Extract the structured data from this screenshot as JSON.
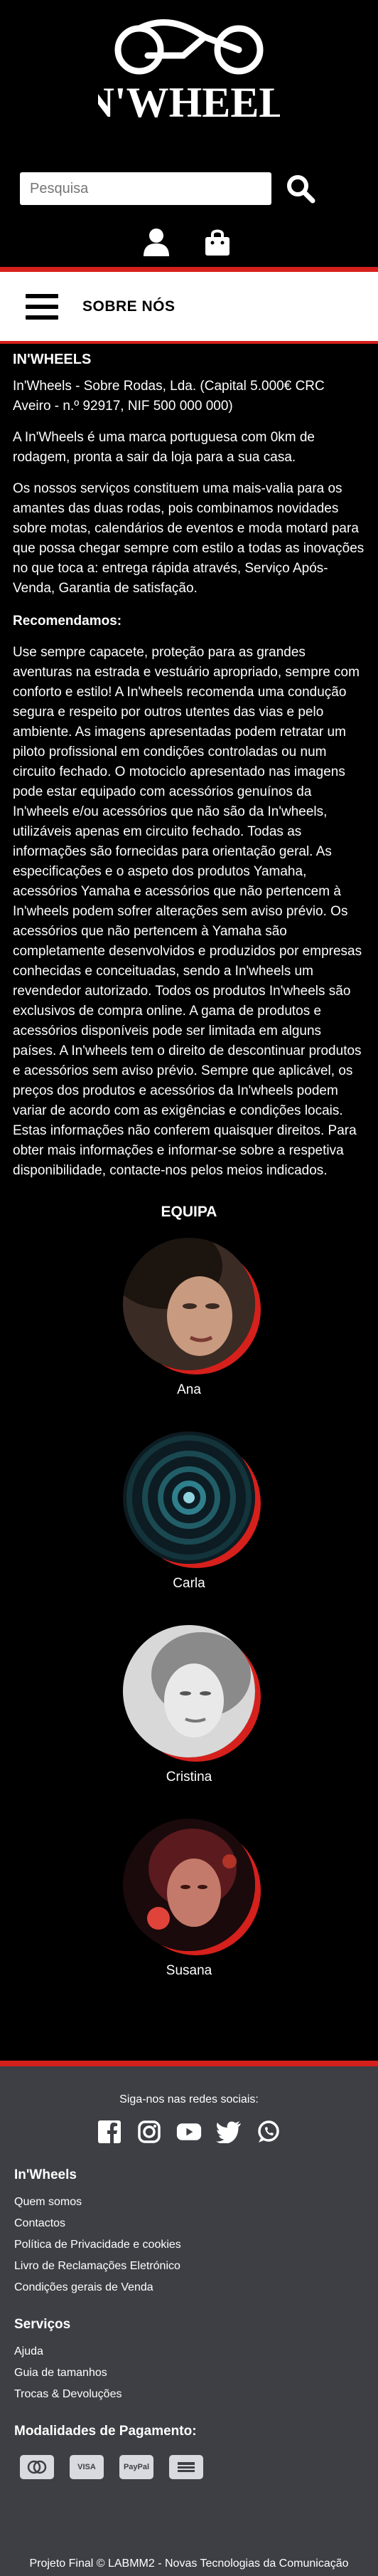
{
  "brand": {
    "logo_text": "IN'WHEELS"
  },
  "search": {
    "placeholder": "Pesquisa"
  },
  "nav": {
    "title": "SOBRE NÓS"
  },
  "about": {
    "heading": "IN'WHEELS",
    "company": "In'Wheels - Sobre Rodas, Lda. (Capital 5.000€ CRC Aveiro - n.º 92917, NIF 500 000 000)",
    "intro": "A In'Wheels é uma marca portuguesa com 0km de rodagem, pronta a sair da loja para a sua casa.",
    "services": "Os nossos serviços constituem uma mais-valia para os amantes das duas rodas, pois combinamos novidades sobre motas, calendários de eventos e moda motard para que possa chegar sempre com estilo a todas as inovações no que toca a: entrega rápida através, Serviço Após-Venda, Garantia de satisfação.",
    "rec_heading": "Recomendamos:",
    "recommendations": "Use sempre capacete, proteção para as grandes aventuras na estrada e vestuário apropriado, sempre com conforto e estilo! A In'wheels recomenda uma condução segura e respeito por outros utentes das vias e pelo ambiente. As imagens apresentadas podem retratar um piloto profissional em condições controladas ou num circuito fechado. O motociclo apresentado nas imagens pode estar equipado com acessórios genuínos da In'wheels e/ou acessórios que não são da In'wheels, utilizáveis apenas em circuito fechado. Todas as informações são fornecidas para orientação geral. As especificações e o aspeto dos produtos Yamaha, acessórios Yamaha e acessórios que não pertencem à In'wheels podem sofrer alterações sem aviso prévio. Os acessórios que não pertencem à Yamaha são completamente desenvolvidos e produzidos por empresas conhecidas e conceituadas, sendo a In'wheels um revendedor autorizado. Todos os produtos In'wheels são exclusivos de compra online. A gama de produtos e acessórios disponíveis pode ser limitada em alguns países. A In'wheels tem o direito de descontinuar produtos e acessórios sem aviso prévio. Sempre que aplicável, os preços dos produtos e acessórios da In'wheels podem variar de acordo com as exigências e condições locais. Estas informações não conferem quaisquer direitos. Para obter mais informações e informar-se sobre a respetiva disponibilidade, contacte-nos pelos meios indicados."
  },
  "team": {
    "title": "EQUIPA",
    "members": [
      {
        "name": "Ana"
      },
      {
        "name": "Carla"
      },
      {
        "name": "Cristina"
      },
      {
        "name": "Susana"
      }
    ]
  },
  "footer": {
    "follow": "Siga-nos nas redes sociais:",
    "social_icons": [
      "facebook-icon",
      "instagram-icon",
      "youtube-icon",
      "twitter-icon",
      "whatsapp-icon"
    ],
    "brand_heading": "In'Wheels",
    "brand_links": [
      "Quem somos",
      "Contactos",
      "Política de Privacidade e cookies",
      "Livro de Reclamações Eletrónico",
      "Condições gerais de Venda"
    ],
    "services_heading": "Serviços",
    "services_links": [
      "Ajuda",
      "Guia de tamanhos",
      "Trocas & Devoluções"
    ],
    "payment_heading": "Modalidades de Pagamento:",
    "payment_methods": [
      "mastercard-icon",
      "VISA",
      "PayPal",
      "multibanco-icon"
    ],
    "copyright": "Projeto Final © LABMM2 - Novas Tecnologias da Comunicação"
  },
  "colors": {
    "accent": "#d6201c",
    "footer_bg": "#3e3f44"
  }
}
